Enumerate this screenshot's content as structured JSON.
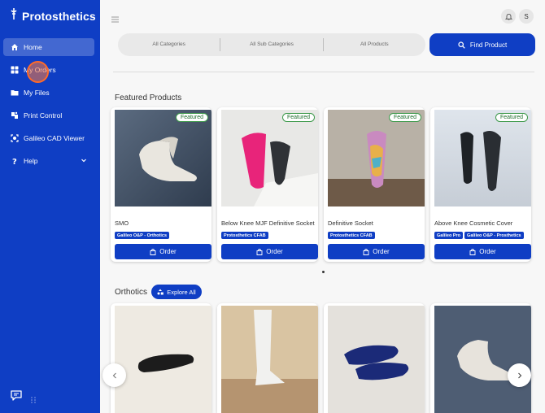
{
  "sidebar": {
    "brand": "Protosthetics",
    "items": [
      {
        "label": "Home",
        "icon": "home-icon"
      },
      {
        "label": "My Orders",
        "icon": "grid-icon"
      },
      {
        "label": "My Files",
        "icon": "folder-icon"
      },
      {
        "label": "Print Control",
        "icon": "print-control-icon"
      },
      {
        "label": "Galileo CAD Viewer",
        "icon": "cad-viewer-icon"
      },
      {
        "label": "Help",
        "icon": "help-icon"
      }
    ]
  },
  "header": {
    "avatar_initial": "S"
  },
  "filters": {
    "categories": "All Categories",
    "sub_categories": "All Sub Categories",
    "products": "All Products",
    "find_button": "Find Product"
  },
  "featured": {
    "title": "Featured Products",
    "badge": "Featured",
    "order_label": "Order",
    "products": [
      {
        "name": "SMO",
        "tags": [
          "Galileo O&P - Orthotics"
        ]
      },
      {
        "name": "Below Knee MJF Definitive Socket",
        "tags": [
          "Protosthetics CFAB"
        ]
      },
      {
        "name": "Definitive Socket",
        "tags": [
          "Protosthetics CFAB"
        ]
      },
      {
        "name": "Above Knee Cosmetic Cover",
        "tags": [
          "Galileo Pro",
          "Galileo O&P - Prosthetics"
        ]
      }
    ]
  },
  "orthotics": {
    "title": "Orthotics",
    "explore_label": "Explore All"
  },
  "colors": {
    "primary": "#0f3ec4",
    "featured_badge": "#3e9a4c",
    "background": "#f7f7f7"
  }
}
